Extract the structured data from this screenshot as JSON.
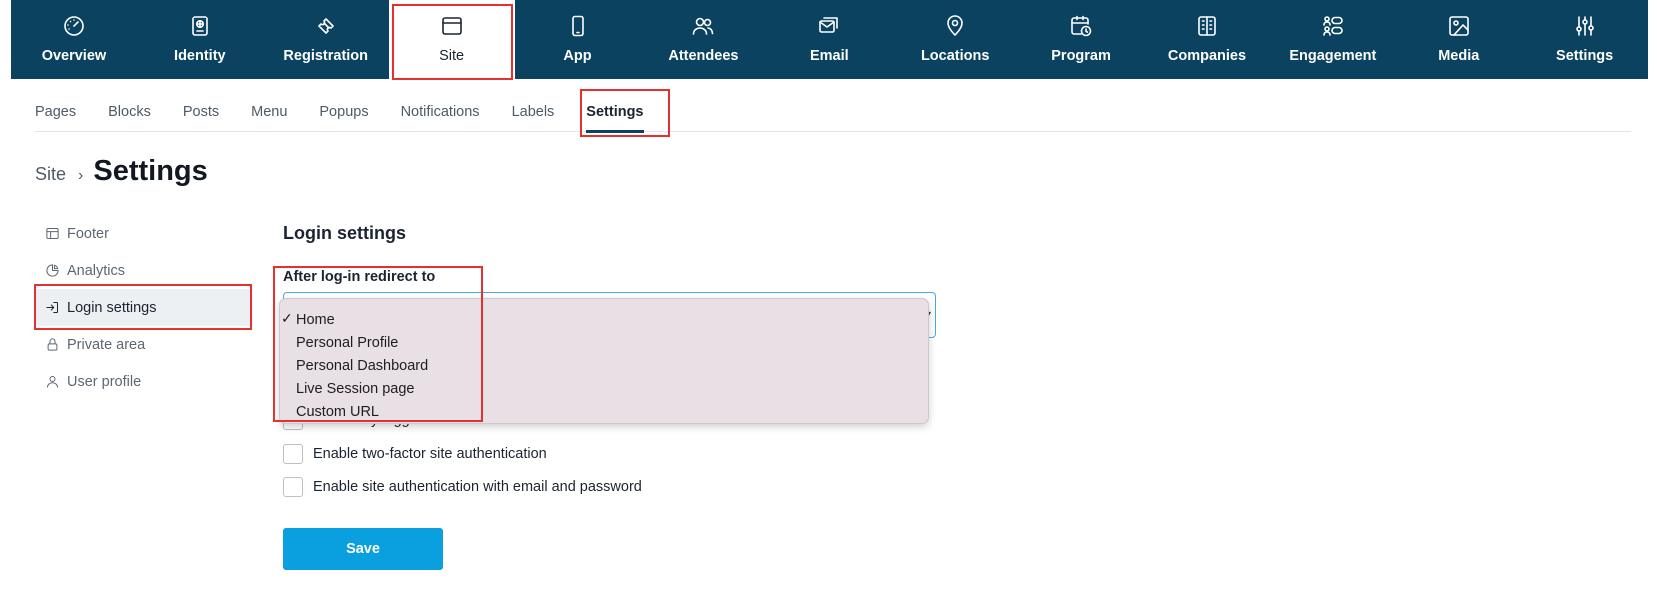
{
  "topnav": {
    "tabs": [
      {
        "label": "Overview",
        "icon": "gauge-icon"
      },
      {
        "label": "Identity",
        "icon": "id-badge-icon"
      },
      {
        "label": "Registration",
        "icon": "ticket-icon"
      },
      {
        "label": "Site",
        "icon": "browser-window-icon",
        "active": true
      },
      {
        "label": "App",
        "icon": "smartphone-icon"
      },
      {
        "label": "Attendees",
        "icon": "users-icon"
      },
      {
        "label": "Email",
        "icon": "mail-icon"
      },
      {
        "label": "Locations",
        "icon": "map-pin-icon"
      },
      {
        "label": "Program",
        "icon": "calendar-clock-icon"
      },
      {
        "label": "Companies",
        "icon": "building-icon"
      },
      {
        "label": "Engagement",
        "icon": "engagement-icon"
      },
      {
        "label": "Media",
        "icon": "image-icon"
      },
      {
        "label": "Settings",
        "icon": "sliders-icon"
      }
    ]
  },
  "subnav": {
    "tabs": [
      "Pages",
      "Blocks",
      "Posts",
      "Menu",
      "Popups",
      "Notifications",
      "Labels",
      "Settings"
    ],
    "active": "Settings"
  },
  "breadcrumb": {
    "parent": "Site",
    "separator": "›",
    "title": "Settings"
  },
  "sidemenu": {
    "items": [
      {
        "label": "Footer",
        "icon": "layout-icon"
      },
      {
        "label": "Analytics",
        "icon": "pie-chart-icon"
      },
      {
        "label": "Login settings",
        "icon": "login-icon",
        "active": true
      },
      {
        "label": "Private area",
        "icon": "lock-icon"
      },
      {
        "label": "User profile",
        "icon": "user-icon"
      }
    ]
  },
  "form": {
    "section_title": "Login settings",
    "redirect_label": "After log-in redirect to",
    "redirect_selected": "Home",
    "redirect_options": [
      "Home",
      "Personal Profile",
      "Personal Dashboard",
      "Live Session page",
      "Custom URL"
    ],
    "checkboxes": [
      {
        "label": "Allow only logged in users",
        "checked": false
      },
      {
        "label": "Enable two-factor site authentication",
        "checked": false
      },
      {
        "label": "Enable site authentication with email and password",
        "checked": false
      }
    ],
    "save_label": "Save"
  },
  "colors": {
    "nav_bg": "#0b4260",
    "accent": "#0aa0df",
    "highlight": "#e53030"
  }
}
